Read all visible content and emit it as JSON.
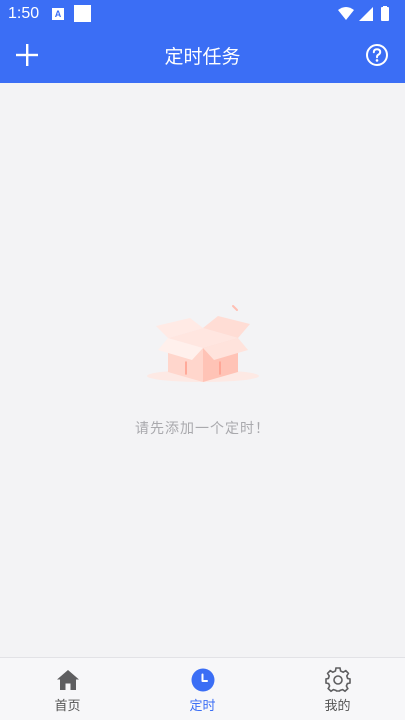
{
  "status_bar": {
    "time": "1:50",
    "notification_badge": "A"
  },
  "app_bar": {
    "title": "定时任务",
    "left_icon": "plus-icon",
    "right_icon": "help-circle-icon"
  },
  "empty_state": {
    "illustration": "empty-box-icon",
    "message": "请先添加一个定时！"
  },
  "bottom_nav": {
    "items": [
      {
        "label": "首页",
        "icon": "home-icon",
        "active": false
      },
      {
        "label": "定时",
        "icon": "clock-icon",
        "active": true
      },
      {
        "label": "我的",
        "icon": "gear-icon",
        "active": false
      }
    ]
  },
  "colors": {
    "primary": "#3b6ef5",
    "background": "#f3f3f5",
    "muted_text": "#a9a9ad",
    "box_pink": "#ffd2c8"
  }
}
